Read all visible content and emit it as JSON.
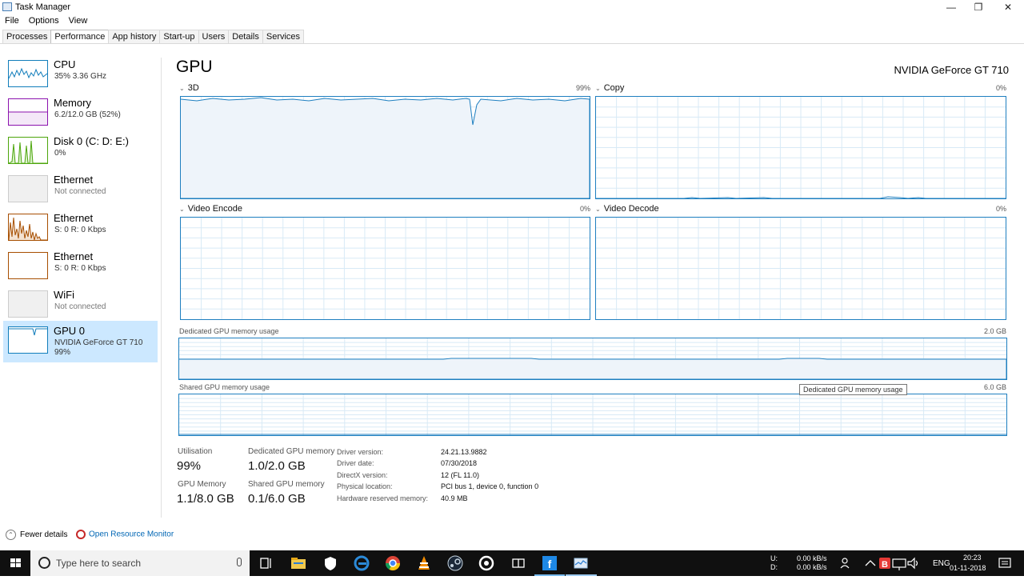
{
  "window": {
    "title": "Task Manager",
    "controls": [
      "minimize",
      "maximize",
      "close"
    ]
  },
  "menu": [
    "File",
    "Options",
    "View"
  ],
  "tabs": [
    "Processes",
    "Performance",
    "App history",
    "Start-up",
    "Users",
    "Details",
    "Services"
  ],
  "active_tab": "Performance",
  "sidebar": {
    "items": [
      {
        "name": "CPU",
        "sub1": "35% 3.36 GHz",
        "sub2": "",
        "color": "#117dbb"
      },
      {
        "name": "Memory",
        "sub1": "6.2/12.0 GB (52%)",
        "sub2": "",
        "color": "#8b12ae"
      },
      {
        "name": "Disk 0 (C: D: E:)",
        "sub1": "0%",
        "sub2": "",
        "color": "#4da60c"
      },
      {
        "name": "Ethernet",
        "sub1": "Not connected",
        "sub2": "",
        "color": "#a74f01"
      },
      {
        "name": "Ethernet",
        "sub1": "S: 0 R: 0 Kbps",
        "sub2": "",
        "color": "#a74f01"
      },
      {
        "name": "Ethernet",
        "sub1": "S: 0 R: 0 Kbps",
        "sub2": "",
        "color": "#a74f01"
      },
      {
        "name": "WiFi",
        "sub1": "Not connected",
        "sub2": "",
        "color": "#a74f01"
      },
      {
        "name": "GPU 0",
        "sub1": "NVIDIA GeForce GT 710",
        "sub2": "99%",
        "color": "#117dbb"
      }
    ],
    "selected": "GPU 0"
  },
  "main": {
    "title": "GPU",
    "model": "NVIDIA GeForce GT 710",
    "engines": [
      {
        "label": "3D",
        "pct": "99%"
      },
      {
        "label": "Copy",
        "pct": "0%"
      },
      {
        "label": "Video Encode",
        "pct": "0%"
      },
      {
        "label": "Video Decode",
        "pct": "0%"
      }
    ],
    "dedicated": {
      "label": "Dedicated GPU memory usage",
      "max": "2.0 GB"
    },
    "shared": {
      "label": "Shared GPU memory usage",
      "max": "6.0 GB"
    },
    "tooltip": "Dedicated GPU memory usage",
    "stats": {
      "utilisation_label": "Utilisation",
      "utilisation": "99%",
      "ded_label": "Dedicated GPU memory",
      "ded": "1.0/2.0 GB",
      "gpumem_label": "GPU Memory",
      "gpumem": "1.1/8.0 GB",
      "shared_label": "Shared GPU memory",
      "shared": "0.1/6.0 GB"
    },
    "details": [
      {
        "label": "Driver version:",
        "value": "24.21.13.9882"
      },
      {
        "label": "Driver date:",
        "value": "07/30/2018"
      },
      {
        "label": "DirectX version:",
        "value": "12 (FL 11.0)"
      },
      {
        "label": "Physical location:",
        "value": "PCI bus 1, device 0, function 0"
      },
      {
        "label": "Hardware reserved memory:",
        "value": "40.9 MB"
      }
    ]
  },
  "footer": {
    "fewer": "Fewer details",
    "resmon": "Open Resource Monitor"
  },
  "taskbar": {
    "search_placeholder": "Type here to search",
    "net_up_label": "U:",
    "net_up": "0.00 kB/s",
    "net_down_label": "D:",
    "net_down": "0.00 kB/s",
    "lang": "ENG",
    "time": "20:23",
    "date": "01-11-2018"
  },
  "colors": {
    "graph_border": "#1e7fc0",
    "grid": "#d8eaf6",
    "accent": "#117dbb",
    "selected": "#cce8ff"
  }
}
